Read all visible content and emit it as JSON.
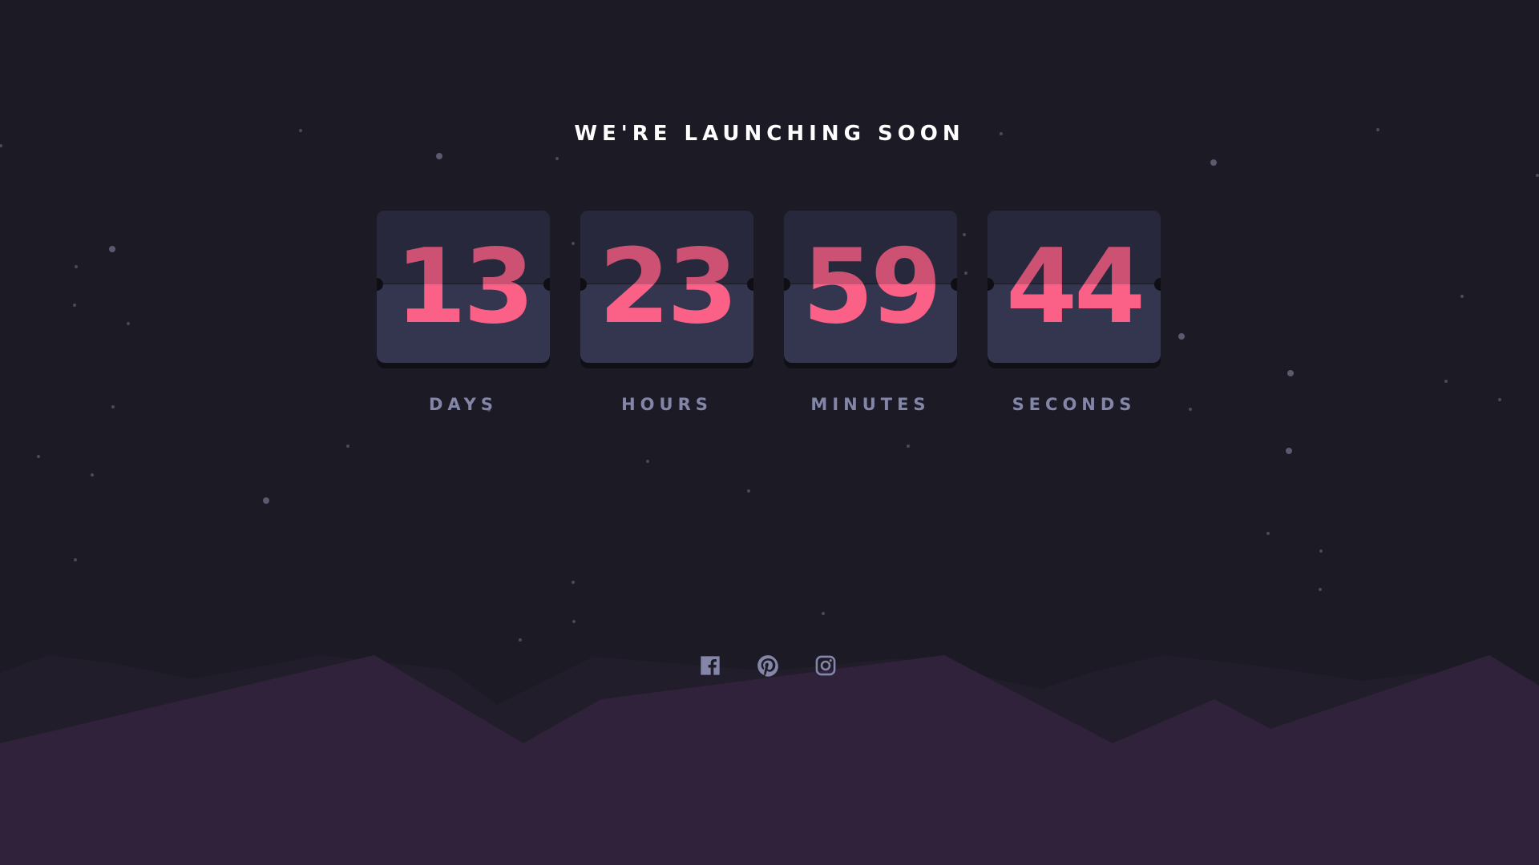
{
  "headline": "WE'RE LAUNCHING SOON",
  "countdown": [
    {
      "value": "13",
      "label": "DAYS"
    },
    {
      "value": "23",
      "label": "HOURS"
    },
    {
      "value": "59",
      "label": "MINUTES"
    },
    {
      "value": "44",
      "label": "SECONDS"
    }
  ],
  "social": [
    {
      "icon": "facebook-icon"
    },
    {
      "icon": "pinterest-icon"
    },
    {
      "icon": "instagram-icon"
    }
  ],
  "colors": {
    "background": "#1c1b25",
    "accent": "#fb6087",
    "card": "#343650",
    "label": "#8486a9",
    "hills": "#30223a"
  }
}
